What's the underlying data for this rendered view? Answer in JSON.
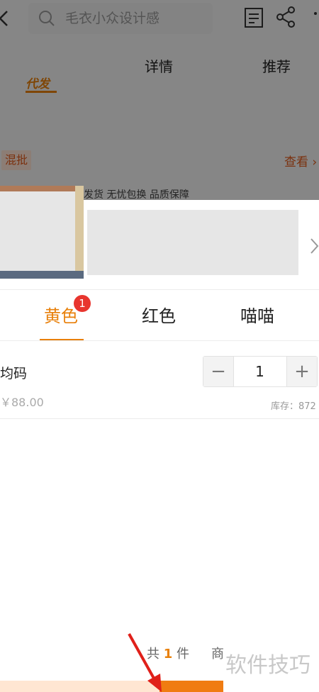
{
  "header": {
    "search_placeholder": "毛衣小众设计感"
  },
  "tabs": {
    "daifa": "代发",
    "detail": "详情",
    "recommend": "推荐"
  },
  "background": {
    "hunpi": "混批",
    "chakan": "查看",
    "promise": "发货 无忧包换 品质保障"
  },
  "sku": {
    "colors": [
      {
        "label": "黄色",
        "badge": "1",
        "active": true
      },
      {
        "label": "红色"
      },
      {
        "label": "喵喵"
      }
    ],
    "size": "均码",
    "price": "￥88.00",
    "quantity": "1",
    "minus": "−",
    "plus": "+",
    "stock": "库存：872"
  },
  "footer": {
    "total_prefix": "共",
    "total_count": "1",
    "total_suffix": "件",
    "shang": "商"
  },
  "watermark": "软件技巧",
  "colors": {
    "accent": "#e8800b",
    "badge": "#e8352e",
    "arrow": "#e0201a"
  }
}
